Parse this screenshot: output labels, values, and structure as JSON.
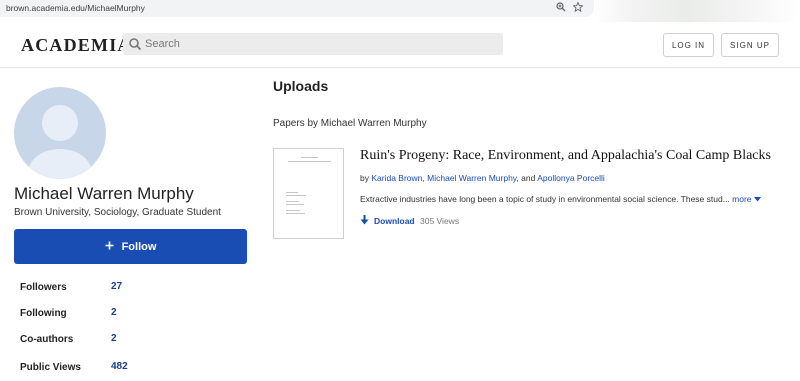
{
  "browser": {
    "url": "brown.academia.edu/MichaelMurphy",
    "zoom_icon": "zoom-icon",
    "bookmark_icon": "star-icon"
  },
  "header": {
    "logo": "ACADEMIA",
    "search_placeholder": "Search",
    "login_label": "LOG IN",
    "signup_label": "SIGN UP"
  },
  "profile": {
    "name": "Michael Warren Murphy",
    "affiliation": "Brown University, Sociology, Graduate Student",
    "follow_icon": "plus",
    "follow_label": "Follow",
    "stats": [
      {
        "label": "Followers",
        "value": "27"
      },
      {
        "label": "Following",
        "value": "2"
      },
      {
        "label": "Co-authors",
        "value": "2"
      },
      {
        "label": "Public Views",
        "value": "482"
      }
    ]
  },
  "main": {
    "section_title": "Uploads",
    "papers_by": "Papers by Michael Warren Murphy",
    "paper": {
      "title": "Ruin's Progeny: Race, Environment, and Appalachia's Coal Camp Blacks",
      "by_label": "by",
      "authors": [
        "Karida Brown",
        "Michael Warren Murphy",
        "Apollonya Porcelli"
      ],
      "author_sep": ",",
      "author_and": ", and",
      "abstract": "Extractive industries have long been a topic of study in environmental social science. These stud...",
      "more_label": "more",
      "download_label": "Download",
      "views": "305 Views"
    }
  },
  "colors": {
    "accent": "#1a4db4",
    "avatar_bg": "#c8d6ea"
  }
}
